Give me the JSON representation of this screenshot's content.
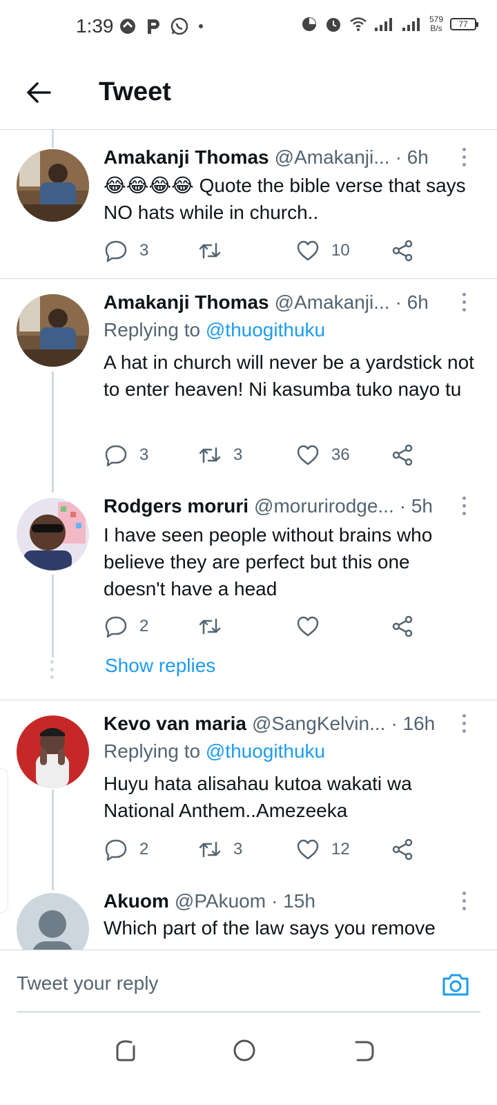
{
  "status_bar": {
    "time": "1:39",
    "net_speed_value": "579",
    "net_speed_unit": "B/s",
    "battery": "77"
  },
  "header": {
    "title": "Tweet"
  },
  "tweets": [
    {
      "name": "Amakanji Thomas",
      "handle": "@Amakanji...",
      "time": "· 6h",
      "replying_prefix": "",
      "replying_to": "",
      "text": "😂😂😂😂 Quote the bible verse that says NO hats while in church..",
      "replies": "3",
      "retweets": "",
      "likes": "10"
    },
    {
      "name": "Amakanji Thomas",
      "handle": "@Amakanji...",
      "time": "· 6h",
      "replying_prefix": "Replying to",
      "replying_to": "@thuogithuku",
      "text": "A hat in church will never be a yardstick not to enter heaven! Ni kasumba tuko nayo tu",
      "replies": "3",
      "retweets": "3",
      "likes": "36"
    },
    {
      "name": "Rodgers moruri",
      "handle": "@morurirodge...",
      "time": "· 5h",
      "replying_prefix": "",
      "replying_to": "",
      "text": "I have seen people without brains who believe they are perfect but this one doesn't have a head",
      "replies": "2",
      "retweets": "",
      "likes": ""
    },
    {
      "name": "Kevo van maria",
      "handle": "@SangKelvin...",
      "time": "· 16h",
      "replying_prefix": "Replying to",
      "replying_to": "@thuogithuku",
      "text": "Huyu hata alisahau kutoa wakati wa National Anthem..Amezeeka",
      "replies": "2",
      "retweets": "3",
      "likes": "12"
    },
    {
      "name": "Akuom",
      "handle": "@PAkuom",
      "time": "· 15h",
      "replying_prefix": "",
      "replying_to": "",
      "text": "Which part of the law says you remove",
      "replies": "",
      "retweets": "",
      "likes": ""
    }
  ],
  "show_replies": "Show replies",
  "composer": {
    "placeholder": "Tweet your reply"
  },
  "icons": {
    "back": "arrow-left-icon",
    "reply": "reply-bubble-icon",
    "retweet": "retweet-icon",
    "like": "heart-icon",
    "share": "share-icon",
    "more": "more-vertical-icon",
    "camera": "camera-icon"
  },
  "colors": {
    "accent": "#1d9bf0",
    "text": "#0f1419",
    "secondary": "#536471",
    "divider": "#cfd9de"
  }
}
